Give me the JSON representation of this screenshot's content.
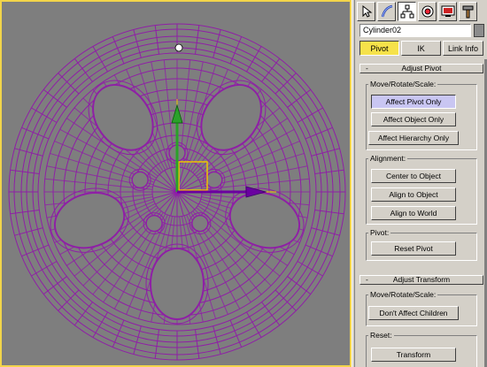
{
  "viewport": {
    "active_border_color": "#f2d44a",
    "background_color": "#7e7e7e",
    "wireframe_color": "#8f1fa6",
    "pivot_gizmo": {
      "x_axis_color": "#6a00a0",
      "y_axis_color": "#2aa12a",
      "pivot_box_color": "#f2c200"
    }
  },
  "command_panel": {
    "tabs": [
      {
        "icon": "create-arrow-icon"
      },
      {
        "icon": "modify-curve-icon"
      },
      {
        "icon": "hierarchy-icon",
        "active": true
      },
      {
        "icon": "motion-icon"
      },
      {
        "icon": "display-icon"
      },
      {
        "icon": "utilities-hammer-icon"
      }
    ],
    "object_name": "Cylinder02",
    "object_color": "#8c8c8c",
    "modes": {
      "pivot": "Pivot",
      "ik": "IK",
      "link_info": "Link Info",
      "active": "Pivot"
    },
    "adjust_pivot": {
      "collapse_symbol": "-",
      "title": "Adjust Pivot",
      "move_group": {
        "label": "Move/Rotate/Scale:",
        "affect_pivot_only": "Affect Pivot Only",
        "affect_object_only": "Affect Object Only",
        "affect_hierarchy_only": "Affect Hierarchy Only"
      },
      "alignment_group": {
        "label": "Alignment:",
        "center_to_object": "Center to Object",
        "align_to_object": "Align to Object",
        "align_to_world": "Align to World"
      },
      "pivot_group": {
        "label": "Pivot:",
        "reset_pivot": "Reset Pivot"
      }
    },
    "adjust_transform": {
      "collapse_symbol": "-",
      "title": "Adjust Transform",
      "move_group": {
        "label": "Move/Rotate/Scale:",
        "dont_affect_children": "Don't Affect Children"
      },
      "reset_group": {
        "label": "Reset:",
        "transform": "Transform"
      }
    }
  }
}
